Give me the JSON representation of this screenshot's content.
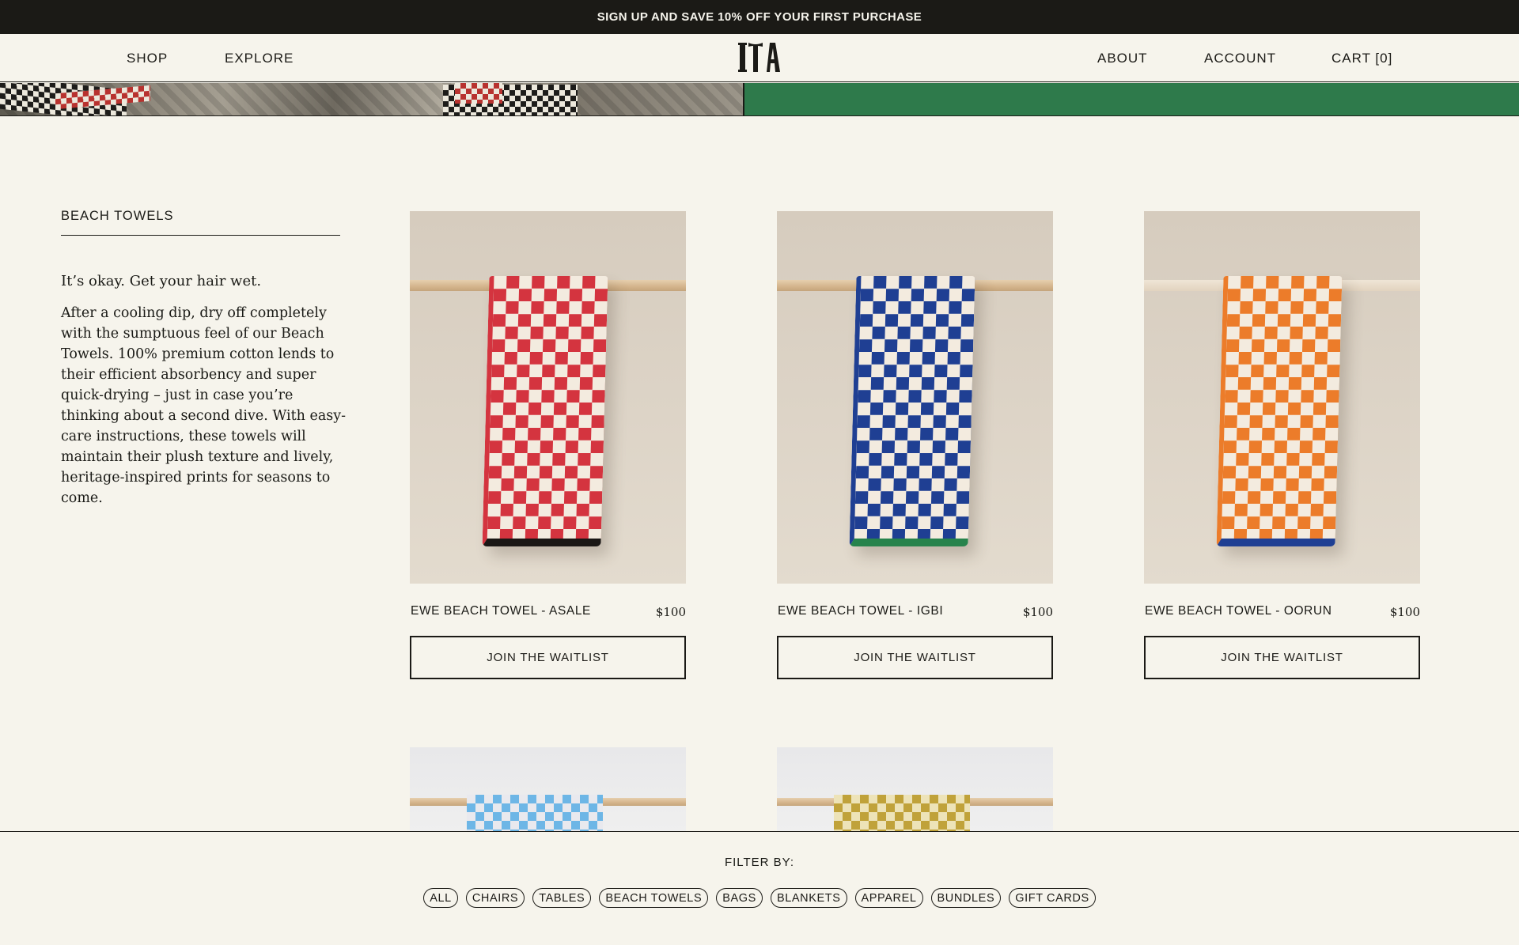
{
  "announcement": "SIGN UP AND SAVE 10% OFF YOUR FIRST PURCHASE",
  "header": {
    "left_nav": [
      "SHOP",
      "EXPLORE"
    ],
    "logo": "ITA",
    "right_nav": [
      "ABOUT",
      "ACCOUNT",
      "CART [0]"
    ]
  },
  "collection": {
    "title": "BEACH TOWELS",
    "tagline": "It’s okay. Get your hair wet.",
    "description": "After a cooling dip, dry off completely with the sumptuous feel of our Beach Towels. 100% premium cotton lends to their efficient absorbency and super quick-drying – just in case you’re thinking about a second dive. With easy-care instructions, these towels will maintain their plush texture and lively, heritage-inspired prints for seasons to come."
  },
  "products": [
    {
      "name": "EWE BEACH TOWEL - ASALE",
      "price": "$100",
      "button": "JOIN THE WAITLIST",
      "colors": [
        "#d4343f",
        "#1a1715",
        "#f3ebdf"
      ]
    },
    {
      "name": "EWE BEACH TOWEL - IGBI",
      "price": "$100",
      "button": "JOIN THE WAITLIST",
      "colors": [
        "#1f3f93",
        "#27834c",
        "#f3ebdf"
      ]
    },
    {
      "name": "EWE BEACH TOWEL - OORUN",
      "price": "$100",
      "button": "JOIN THE WAITLIST",
      "colors": [
        "#ec7c2a",
        "#1f3f93",
        "#f3ebdf"
      ]
    }
  ],
  "partial_products": [
    {
      "colors": [
        "#6db6e6",
        "#4a1d2a",
        "#e9e9ee"
      ]
    },
    {
      "colors": [
        "#c0a23a",
        "#8a7a3a",
        "#ede3b8"
      ]
    }
  ],
  "filter": {
    "label": "FILTER BY:",
    "options": [
      "ALL",
      "CHAIRS",
      "TABLES",
      "BEACH TOWELS",
      "BAGS",
      "BLANKETS",
      "APPAREL",
      "BUNDLES",
      "GIFT CARDS"
    ]
  },
  "colors": {
    "background": "#f6f4ec",
    "ink": "#1b1a16",
    "hero_green": "#2e7a4b"
  }
}
